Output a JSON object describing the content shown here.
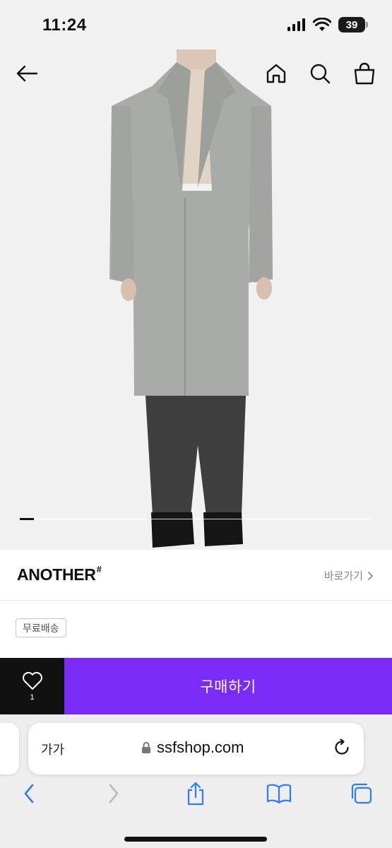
{
  "status_bar": {
    "time": "11:24",
    "battery": "39",
    "icons": [
      "cellular-signal-icon",
      "wifi-icon",
      "battery-icon"
    ]
  },
  "hero": {
    "nav_icons": [
      "back-arrow-icon",
      "home-icon",
      "search-icon",
      "shopping-bag-icon"
    ],
    "image_alt": "product-photo-grey-overcoat",
    "slide_current": 1
  },
  "brand": {
    "name": "ANOTHER",
    "mark": "#",
    "shortcut_label": "바로가기"
  },
  "badge": {
    "label": "무료배송"
  },
  "buy_bar": {
    "like_count": "1",
    "buy_label": "구매하기",
    "accent_color": "#7a2cf5"
  },
  "safari": {
    "text_size_label": "가가",
    "url": "ssfshop.com",
    "toolbar_icons": [
      "back-icon",
      "forward-icon",
      "share-icon",
      "bookmarks-icon",
      "tabs-icon"
    ]
  }
}
